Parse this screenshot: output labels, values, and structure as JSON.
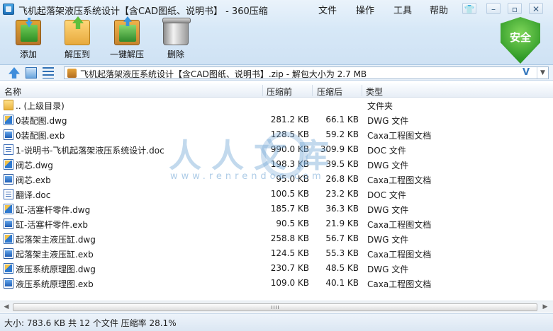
{
  "window": {
    "title": "飞机起落架液压系统设计【含CAD图纸、说明书】 - 360压缩",
    "menus": [
      "文件",
      "操作",
      "工具",
      "帮助"
    ],
    "controls": [
      "shirt-icon",
      "minimize",
      "restore",
      "close"
    ]
  },
  "toolbar": {
    "add": "添加",
    "extract_to": "解压到",
    "one_key_extract": "一键解压",
    "delete": "删除",
    "security_badge": "安全"
  },
  "address": {
    "path": "飞机起落架液压系统设计【含CAD图纸、说明书】.zip - 解包大小为 2.7 MB",
    "indicator": "V"
  },
  "columns": {
    "name": "名称",
    "original_size": "压缩前",
    "compressed_size": "压缩后",
    "type": "类型"
  },
  "files": [
    {
      "icon": "folder-icon",
      "name": ".. (上级目录)",
      "original": "",
      "compressed": "",
      "type": "文件夹"
    },
    {
      "icon": "dwg-file-icon",
      "name": "0装配图.dwg",
      "original": "281.2 KB",
      "compressed": "66.1 KB",
      "type": "DWG 文件"
    },
    {
      "icon": "exb-file-icon",
      "name": "0装配图.exb",
      "original": "128.5 KB",
      "compressed": "59.2 KB",
      "type": "Caxa工程图文档"
    },
    {
      "icon": "doc-file-icon",
      "name": "1-说明书-飞机起落架液压系统设计.doc",
      "original": "990.0 KB",
      "compressed": "309.9 KB",
      "type": "DOC 文件"
    },
    {
      "icon": "dwg-file-icon",
      "name": "阀芯.dwg",
      "original": "198.3 KB",
      "compressed": "39.5 KB",
      "type": "DWG 文件"
    },
    {
      "icon": "exb-file-icon",
      "name": "阀芯.exb",
      "original": "95.0 KB",
      "compressed": "26.8 KB",
      "type": "Caxa工程图文档"
    },
    {
      "icon": "doc-file-icon",
      "name": "翻译.doc",
      "original": "100.5 KB",
      "compressed": "23.2 KB",
      "type": "DOC 文件"
    },
    {
      "icon": "dwg-file-icon",
      "name": "缸-活塞杆零件.dwg",
      "original": "185.7 KB",
      "compressed": "36.3 KB",
      "type": "DWG 文件"
    },
    {
      "icon": "exb-file-icon",
      "name": "缸-活塞杆零件.exb",
      "original": "90.5 KB",
      "compressed": "21.9 KB",
      "type": "Caxa工程图文档"
    },
    {
      "icon": "dwg-file-icon",
      "name": "起落架主液压缸.dwg",
      "original": "258.8 KB",
      "compressed": "56.7 KB",
      "type": "DWG 文件"
    },
    {
      "icon": "exb-file-icon",
      "name": "起落架主液压缸.exb",
      "original": "124.5 KB",
      "compressed": "55.3 KB",
      "type": "Caxa工程图文档"
    },
    {
      "icon": "dwg-file-icon",
      "name": "液压系统原理图.dwg",
      "original": "230.7 KB",
      "compressed": "48.5 KB",
      "type": "DWG 文件"
    },
    {
      "icon": "exb-file-icon",
      "name": "液压系统原理图.exb",
      "original": "109.0 KB",
      "compressed": "40.1 KB",
      "type": "Caxa工程图文档"
    }
  ],
  "watermark": {
    "text": "人人文库",
    "url": "www.renrendoc.com"
  },
  "status": {
    "text": "大小: 783.6 KB 共 12 个文件 压缩率 28.1%"
  }
}
